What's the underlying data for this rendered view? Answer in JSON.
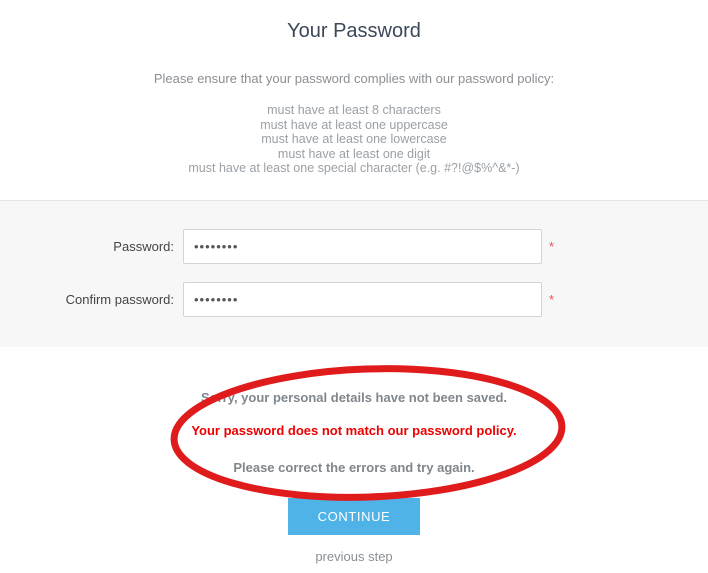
{
  "header": {
    "title": "Your Password",
    "intro": "Please ensure that your password complies with our password policy:",
    "policy": [
      "must have at least 8 characters",
      "must have at least one uppercase",
      "must have at least one lowercase",
      "must have at least one digit",
      "must have at least one special character (e.g. #?!@$%^&*-)"
    ]
  },
  "form": {
    "password": {
      "label": "Password:",
      "value": "••••••••",
      "placeholder": "",
      "required_marker": "*"
    },
    "confirm_password": {
      "label": "Confirm password:",
      "value": "••••••••",
      "placeholder": "",
      "required_marker": "*"
    }
  },
  "messages": {
    "not_saved": "Sorry, your personal details have not been saved.",
    "policy_error": "Your password does not match our password policy.",
    "retry": "Please correct the errors and try again."
  },
  "actions": {
    "continue_label": "CONTINUE",
    "previous_step_label": "previous step"
  },
  "colors": {
    "button_blue": "#4fb3e8",
    "error_red": "#ee0000",
    "annotation_red": "#e01b1b",
    "required_star": "#e8505b",
    "panel_background": "#f7f7f7",
    "title_text": "#3c4858",
    "muted_text": "#8a8f94"
  },
  "annotation": {
    "shape": "ellipse",
    "name": "red-highlight-ellipse"
  }
}
